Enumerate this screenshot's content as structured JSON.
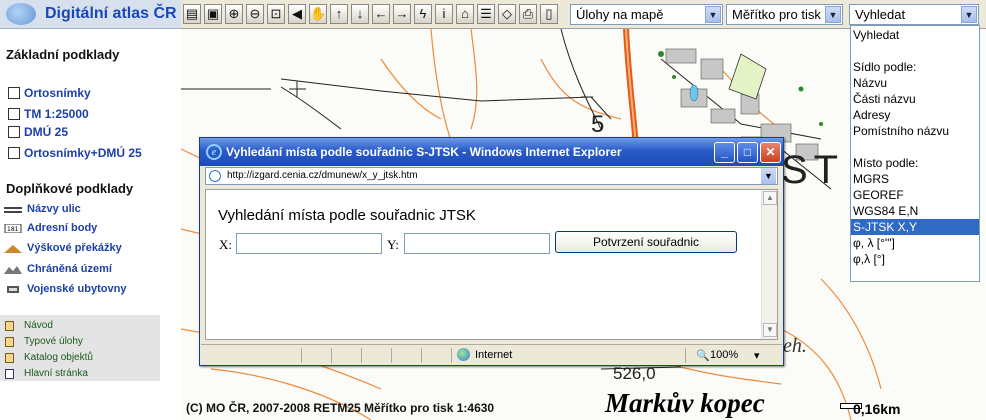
{
  "app": {
    "title": "Digitální atlas ČR"
  },
  "left_panel": {
    "base_title": "Základní podklady",
    "base_layers": [
      {
        "label": "Ortosnímky",
        "checked": false
      },
      {
        "label": "TM 1:25000",
        "checked": false
      },
      {
        "label": "DMÚ 25",
        "checked": false
      },
      {
        "label": "Ortosnímky+DMÚ 25",
        "checked": false
      }
    ],
    "supp_title": "Doplňkové podklady",
    "supp_layers": [
      {
        "label": "Názvy ulic",
        "icon": "street-names-icon"
      },
      {
        "label": "Adresní body",
        "icon": "address-points-icon"
      },
      {
        "label": "Výškové překážky",
        "icon": "height-obstacles-icon"
      },
      {
        "label": "Chráněná území",
        "icon": "protected-areas-icon"
      },
      {
        "label": "Vojenské ubytovny",
        "icon": "military-lodging-icon"
      }
    ],
    "links": [
      {
        "label": "Návod"
      },
      {
        "label": "Typové úlohy"
      },
      {
        "label": "Katalog objektů"
      },
      {
        "label": "Hlavní stránka"
      }
    ]
  },
  "toolbar": {
    "tools": [
      {
        "icon": "layers-icon",
        "glyph": "▤"
      },
      {
        "icon": "legend-icon",
        "glyph": "▣"
      },
      {
        "icon": "zoom-in-icon",
        "glyph": "⊕"
      },
      {
        "icon": "zoom-out-icon",
        "glyph": "⊖"
      },
      {
        "icon": "zoom-rect-icon",
        "glyph": "⊡"
      },
      {
        "icon": "back-icon",
        "glyph": "◀"
      },
      {
        "icon": "pan-hand-icon",
        "glyph": "✋"
      },
      {
        "icon": "arrow-up-icon",
        "glyph": "↑"
      },
      {
        "icon": "arrow-down-icon",
        "glyph": "↓"
      },
      {
        "icon": "arrow-left-icon",
        "glyph": "←"
      },
      {
        "icon": "arrow-right-icon",
        "glyph": "→"
      },
      {
        "icon": "lightning-icon",
        "glyph": "ϟ"
      },
      {
        "icon": "info-icon",
        "glyph": "i"
      },
      {
        "icon": "measure-icon",
        "glyph": "⌂"
      },
      {
        "icon": "ruler-icon",
        "glyph": "☰"
      },
      {
        "icon": "eraser-icon",
        "glyph": "◇"
      },
      {
        "icon": "print-icon",
        "glyph": "⎙"
      },
      {
        "icon": "bookmark-icon",
        "glyph": "▯"
      }
    ],
    "tasks_select": "Úlohy na mapě",
    "scale_select": "Měřítko pro tisk",
    "search_select": "Vyhledat"
  },
  "search_dropdown": {
    "items": [
      {
        "label": "Vyhledat",
        "selected": false
      },
      {
        "label": "",
        "selected": false
      },
      {
        "label": "Sídlo podle:",
        "selected": false
      },
      {
        "label": "Názvu",
        "selected": false
      },
      {
        "label": "Části názvu",
        "selected": false
      },
      {
        "label": "Adresy",
        "selected": false
      },
      {
        "label": "Pomístního názvu",
        "selected": false
      },
      {
        "label": "",
        "selected": false
      },
      {
        "label": "Místo podle:",
        "selected": false
      },
      {
        "label": "MGRS",
        "selected": false
      },
      {
        "label": "GEOREF",
        "selected": false
      },
      {
        "label": "WGS84 E,N",
        "selected": false
      },
      {
        "label": "S-JTSK X,Y",
        "selected": true
      },
      {
        "label": "φ, λ [°'\"]",
        "selected": false
      },
      {
        "label": "φ,λ [°]",
        "selected": false
      }
    ]
  },
  "map": {
    "copyright": "(C) MO ČR, 2007-2008 RETM25 Měřítko pro tisk 1:4630",
    "place_name": "Markův kopec",
    "scale_label": "0,16km",
    "map_labels": {
      "st": "ST",
      "num5": "5",
      "eh": "eh.",
      "elev": "526,0"
    }
  },
  "popup": {
    "window_title": "Vyhledání místa podle souřadnic S-JTSK - Windows Internet Explorer",
    "url": "http://izgard.cenia.cz/dmunew/x_y_jtsk.htm",
    "heading": "Vyhledání místa podle souřadnic JTSK",
    "x_label": "X:",
    "y_label": "Y:",
    "x_value": "",
    "y_value": "",
    "confirm_label": "Potvrzení souřadnic",
    "status_zone": "Internet",
    "zoom": "100%"
  }
}
